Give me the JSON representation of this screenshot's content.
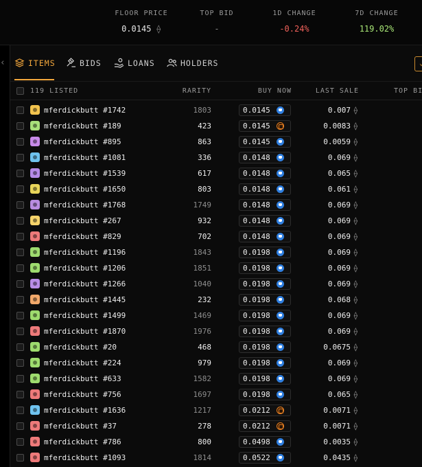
{
  "stats": {
    "floor_label": "FLOOR PRICE",
    "floor_value": "0.0145",
    "topbid_label": "TOP BID",
    "topbid_value": "-",
    "change1d_label": "1D CHANGE",
    "change1d_value": "-0.24%",
    "change7d_label": "7D CHANGE",
    "change7d_value": "119.02%"
  },
  "colors": {
    "accent": "#f3a73c",
    "negative": "#f0615a",
    "positive": "#a8e676"
  },
  "tabs": [
    {
      "label": "ITEMS",
      "icon": "layers-icon",
      "active": true
    },
    {
      "label": "BIDS",
      "icon": "gavel-icon",
      "active": false
    },
    {
      "label": "LOANS",
      "icon": "hand-coin-icon",
      "active": false
    },
    {
      "label": "HOLDERS",
      "icon": "users-icon",
      "active": false
    }
  ],
  "table": {
    "columns": {
      "listed": "119 LISTED",
      "rarity": "RARITY",
      "buy_now": "BUY NOW",
      "last_sale": "LAST SALE",
      "top_bid": "TOP BI"
    },
    "rows": [
      {
        "name": "mferdickbutt #1742",
        "rarity": "1803",
        "buy_now": "0.0145",
        "market": "opensea",
        "last_sale": "0.007",
        "avatar": "#f2c34e"
      },
      {
        "name": "mferdickbutt #189",
        "rarity": "423",
        "buy_now": "0.0145",
        "market": "blur",
        "last_sale": "0.0083",
        "avatar": "#a8e07a"
      },
      {
        "name": "mferdickbutt #895",
        "rarity": "863",
        "buy_now": "0.0145",
        "market": "opensea",
        "last_sale": "0.0059",
        "avatar": "#c78ae8"
      },
      {
        "name": "mferdickbutt #1081",
        "rarity": "336",
        "buy_now": "0.0148",
        "market": "opensea",
        "last_sale": "0.069",
        "avatar": "#6fc3ef"
      },
      {
        "name": "mferdickbutt #1539",
        "rarity": "617",
        "buy_now": "0.0148",
        "market": "opensea",
        "last_sale": "0.065",
        "avatar": "#b58ae8"
      },
      {
        "name": "mferdickbutt #1650",
        "rarity": "803",
        "buy_now": "0.0148",
        "market": "opensea",
        "last_sale": "0.061",
        "avatar": "#e8d55a"
      },
      {
        "name": "mferdickbutt #1768",
        "rarity": "1749",
        "buy_now": "0.0148",
        "market": "opensea",
        "last_sale": "0.069",
        "avatar": "#b98ce0"
      },
      {
        "name": "mferdickbutt #267",
        "rarity": "932",
        "buy_now": "0.0148",
        "market": "opensea",
        "last_sale": "0.069",
        "avatar": "#f5d36a"
      },
      {
        "name": "mferdickbutt #829",
        "rarity": "702",
        "buy_now": "0.0148",
        "market": "opensea",
        "last_sale": "0.069",
        "avatar": "#ee7a7a"
      },
      {
        "name": "mferdickbutt #1196",
        "rarity": "1843",
        "buy_now": "0.0198",
        "market": "opensea",
        "last_sale": "0.069",
        "avatar": "#9edb6e"
      },
      {
        "name": "mferdickbutt #1206",
        "rarity": "1851",
        "buy_now": "0.0198",
        "market": "opensea",
        "last_sale": "0.069",
        "avatar": "#9edb6e"
      },
      {
        "name": "mferdickbutt #1266",
        "rarity": "1040",
        "buy_now": "0.0198",
        "market": "opensea",
        "last_sale": "0.069",
        "avatar": "#b88de6"
      },
      {
        "name": "mferdickbutt #1445",
        "rarity": "232",
        "buy_now": "0.0198",
        "market": "opensea",
        "last_sale": "0.068",
        "avatar": "#f2a86a"
      },
      {
        "name": "mferdickbutt #1499",
        "rarity": "1469",
        "buy_now": "0.0198",
        "market": "opensea",
        "last_sale": "0.069",
        "avatar": "#9edb6e"
      },
      {
        "name": "mferdickbutt #1870",
        "rarity": "1976",
        "buy_now": "0.0198",
        "market": "opensea",
        "last_sale": "0.069",
        "avatar": "#ee7a7a"
      },
      {
        "name": "mferdickbutt #20",
        "rarity": "468",
        "buy_now": "0.0198",
        "market": "opensea",
        "last_sale": "0.0675",
        "avatar": "#9edb6e"
      },
      {
        "name": "mferdickbutt #224",
        "rarity": "979",
        "buy_now": "0.0198",
        "market": "opensea",
        "last_sale": "0.069",
        "avatar": "#9edb6e"
      },
      {
        "name": "mferdickbutt #633",
        "rarity": "1582",
        "buy_now": "0.0198",
        "market": "opensea",
        "last_sale": "0.069",
        "avatar": "#9edb6e"
      },
      {
        "name": "mferdickbutt #756",
        "rarity": "1697",
        "buy_now": "0.0198",
        "market": "opensea",
        "last_sale": "0.065",
        "avatar": "#ee7a7a"
      },
      {
        "name": "mferdickbutt #1636",
        "rarity": "1217",
        "buy_now": "0.0212",
        "market": "blur",
        "last_sale": "0.0071",
        "avatar": "#6fc3ef"
      },
      {
        "name": "mferdickbutt #37",
        "rarity": "278",
        "buy_now": "0.0212",
        "market": "blur",
        "last_sale": "0.0071",
        "avatar": "#ee7a7a"
      },
      {
        "name": "mferdickbutt #786",
        "rarity": "800",
        "buy_now": "0.0498",
        "market": "opensea",
        "last_sale": "0.0035",
        "avatar": "#ee7a7a"
      },
      {
        "name": "mferdickbutt #1093",
        "rarity": "1814",
        "buy_now": "0.0522",
        "market": "opensea",
        "last_sale": "0.0435",
        "avatar": "#ee7a7a"
      }
    ]
  }
}
